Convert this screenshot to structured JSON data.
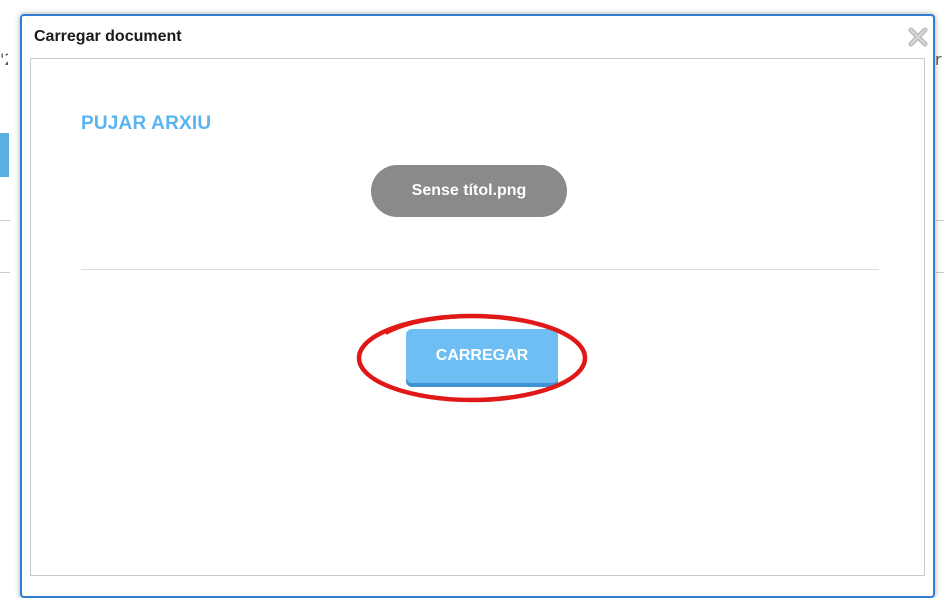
{
  "background": {
    "left_fragment": "'2",
    "right_fragment": "r"
  },
  "dialog": {
    "title": "Carregar document",
    "close_icon": "close-icon",
    "section_title": "PUJAR ARXIU",
    "file_name": "Sense títol.png",
    "upload_button_label": "CARREGAR"
  },
  "colors": {
    "accent": "#5ab4f0",
    "button": "#6fbef3",
    "file_pill": "#8a8a8a",
    "highlight": "#e01818",
    "dialog_border": "#2f7fd1"
  }
}
